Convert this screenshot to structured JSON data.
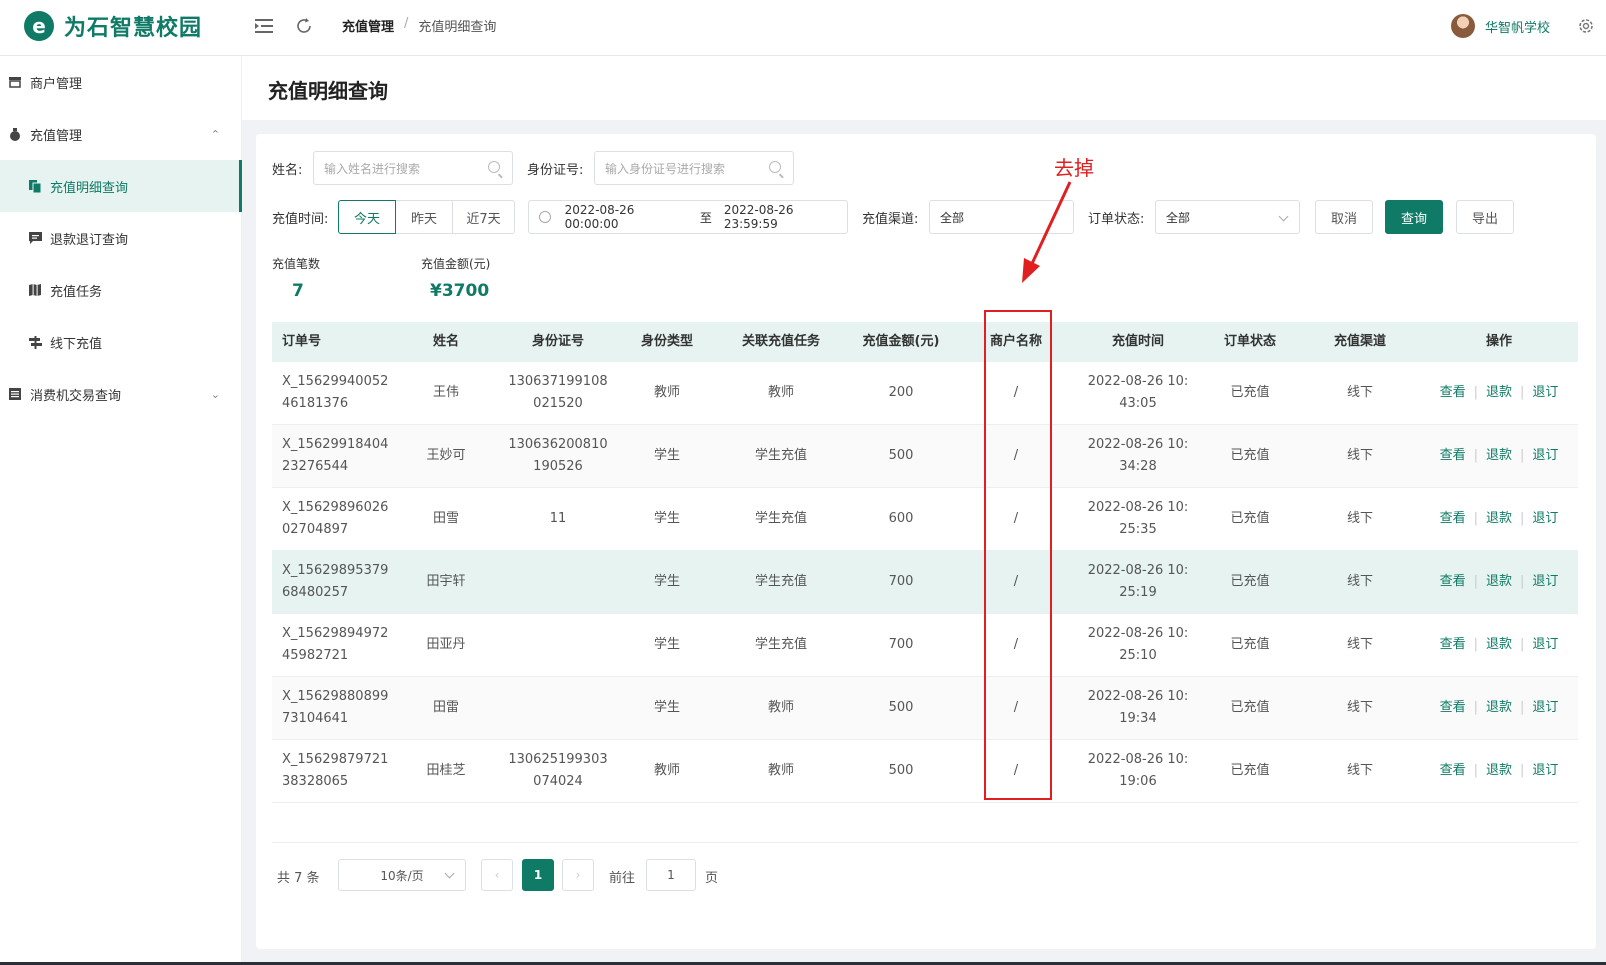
{
  "header": {
    "logo_letter": "e",
    "logo_text": "为石智慧校园",
    "breadcrumb": [
      "充值管理",
      "/",
      "充值明细查询"
    ],
    "username": "华智帆学校"
  },
  "sidebar": {
    "items": [
      {
        "label": "商户管理",
        "icon": "store-icon"
      },
      {
        "label": "充值管理",
        "icon": "moneybag-icon",
        "chevron": "⌃"
      },
      {
        "label": "充值明细查询",
        "icon": "documents-icon"
      },
      {
        "label": "退款退订查询",
        "icon": "message-icon"
      },
      {
        "label": "充值任务",
        "icon": "map-icon"
      },
      {
        "label": "线下充值",
        "icon": "signpost-icon"
      },
      {
        "label": "消费机交易查询",
        "icon": "list-icon",
        "chevron": "⌄"
      }
    ]
  },
  "main": {
    "title": "充值明细查询",
    "filters": {
      "name_label": "姓名:",
      "name_placeholder": "输入姓名进行搜索",
      "id_label": "身份证号:",
      "id_placeholder": "输入身份证号进行搜索",
      "time_label": "充值时间:",
      "time_options": [
        "今天",
        "昨天",
        "近7天"
      ],
      "date_start": "2022-08-26 00:00:00",
      "date_sep": "至",
      "date_end": "2022-08-26 23:59:59",
      "channel_label": "充值渠道:",
      "channel_value": "全部",
      "status_label": "订单状态:",
      "status_value": "全部",
      "cancel": "取消",
      "query": "查询",
      "export": "导出"
    },
    "stats": {
      "count_label": "充值笔数",
      "count_value": "7",
      "amount_label": "充值金额(元)",
      "amount_value": "¥3700"
    },
    "table": {
      "columns": [
        "订单号",
        "姓名",
        "身份证号",
        "身份类型",
        "关联充值任务",
        "充值金额(元)",
        "商户名称",
        "充值时间",
        "订单状态",
        "充值渠道",
        "操作"
      ],
      "rows": [
        {
          "order": "X_15629940052\n46181376",
          "name": "王伟",
          "id": "130637199108\n021520",
          "type": "教师",
          "task": "教师",
          "amount": "200",
          "merchant": "/",
          "time": "2022-08-26 10:\n43:05",
          "status": "已充值",
          "channel": "线下"
        },
        {
          "order": "X_15629918404\n23276544",
          "name": "王妙可",
          "id": "130636200810\n190526",
          "type": "学生",
          "task": "学生充值",
          "amount": "500",
          "merchant": "/",
          "time": "2022-08-26 10:\n34:28",
          "status": "已充值",
          "channel": "线下"
        },
        {
          "order": "X_15629896026\n02704897",
          "name": "田雪",
          "id": "11",
          "type": "学生",
          "task": "学生充值",
          "amount": "600",
          "merchant": "/",
          "time": "2022-08-26 10:\n25:35",
          "status": "已充值",
          "channel": "线下"
        },
        {
          "order": "X_15629895379\n68480257",
          "name": "田宇轩",
          "id": "",
          "type": "学生",
          "task": "学生充值",
          "amount": "700",
          "merchant": "/",
          "time": "2022-08-26 10:\n25:19",
          "status": "已充值",
          "channel": "线下"
        },
        {
          "order": "X_15629894972\n45982721",
          "name": "田亚丹",
          "id": "",
          "type": "学生",
          "task": "学生充值",
          "amount": "700",
          "merchant": "/",
          "time": "2022-08-26 10:\n25:10",
          "status": "已充值",
          "channel": "线下"
        },
        {
          "order": "X_15629880899\n73104641",
          "name": "田雷",
          "id": "",
          "type": "学生",
          "task": "教师",
          "amount": "500",
          "merchant": "/",
          "time": "2022-08-26 10:\n19:34",
          "status": "已充值",
          "channel": "线下"
        },
        {
          "order": "X_15629879721\n38328065",
          "name": "田桂芝",
          "id": "130625199303\n074024",
          "type": "教师",
          "task": "教师",
          "amount": "500",
          "merchant": "/",
          "time": "2022-08-26 10:\n19:06",
          "status": "已充值",
          "channel": "线下"
        }
      ],
      "actions": [
        "查看",
        "退款",
        "退订"
      ]
    },
    "annotation": {
      "text": "去掉",
      "color": "#e02020"
    },
    "pagination": {
      "total": "共 7 条",
      "page_size": "10条/页",
      "prev": "‹",
      "current": "1",
      "next": "›",
      "goto_label": "前往",
      "goto_value": "1",
      "page_suffix": "页"
    }
  },
  "colors": {
    "accent": "#0f7a66",
    "accent_light": "#e6f3f1",
    "annotation": "#e02020"
  }
}
